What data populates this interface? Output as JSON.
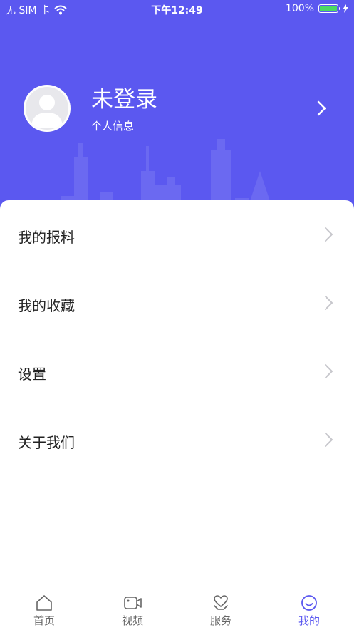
{
  "status_bar": {
    "carrier": "无 SIM 卡",
    "time": "下午12:49",
    "battery": "100%",
    "battery_level": 1.0
  },
  "profile": {
    "name": "未登录",
    "subtitle": "个人信息"
  },
  "menu": [
    {
      "label": "我的报料"
    },
    {
      "label": "我的收藏"
    },
    {
      "label": "设置"
    },
    {
      "label": "关于我们"
    }
  ],
  "tabs": [
    {
      "label": "首页",
      "icon": "home-icon",
      "active": false
    },
    {
      "label": "视频",
      "icon": "video-icon",
      "active": false
    },
    {
      "label": "服务",
      "icon": "heart-hand-icon",
      "active": false
    },
    {
      "label": "我的",
      "icon": "smile-icon",
      "active": true
    }
  ],
  "colors": {
    "accent": "#5b58f0",
    "battery_fill": "#4cd964",
    "arrow": "#c7c7cc"
  }
}
